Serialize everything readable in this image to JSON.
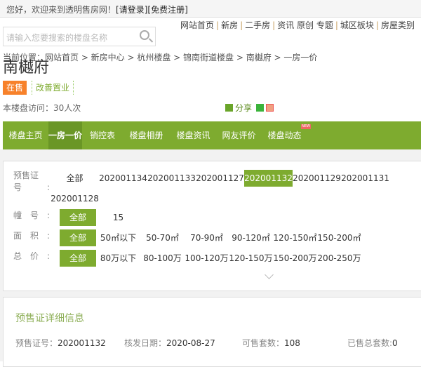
{
  "topbar": {
    "greeting": "您好，欢迎来到透明售房网！",
    "login": "[请登录]",
    "register": "[免费注册]"
  },
  "toplinks": [
    "网站首页",
    "新房",
    "二手房",
    "资讯 原创 专题",
    "城区板块",
    "房屋类别"
  ],
  "search": {
    "placeholder": "请输入您要搜索的楼盘名称",
    "icon": "search-icon"
  },
  "breadcrumb": "当前位置：网站首页 > 新房中心 > 杭州楼盘 > 锦南街道楼盘 > 南樾府 > 一房一价",
  "title": "南樾府",
  "tags": {
    "status": "在售",
    "type": "改善置业"
  },
  "visits": "本楼盘访问：30人次",
  "share": "分享",
  "nav": {
    "items": [
      "楼盘主页",
      "一房一价",
      "销控表",
      "楼盘相册",
      "楼盘资讯",
      "网友评价",
      "楼盘动态"
    ],
    "active": "一房一价",
    "new_badge": "NEW"
  },
  "filters": {
    "cert": {
      "label": "预售证号:",
      "options": [
        "全部",
        "202001134",
        "202001133",
        "202001127",
        "202001132",
        "202001129",
        "202001131",
        "202001128"
      ],
      "selected": "202001132"
    },
    "building": {
      "label": "幢号:",
      "options": [
        "全部",
        "15"
      ],
      "selected": "全部"
    },
    "area": {
      "label": "面积:",
      "options": [
        "全部",
        "50㎡以下",
        "50-70㎡",
        "70-90㎡",
        "90-120㎡",
        "120-150㎡",
        "150-200㎡"
      ],
      "selected": "全部"
    },
    "price": {
      "label": "总价:",
      "options": [
        "全部",
        "80万以下",
        "80-100万",
        "100-120万",
        "120-150万",
        "150-200万",
        "200-250万"
      ],
      "selected": "全部"
    }
  },
  "detail": {
    "title": "预售证详细信息",
    "cert_label": "预售证号：",
    "cert": "202001132",
    "date_label": "核发日期：",
    "date": "2020-08-27",
    "avail_label": "可售套数：",
    "avail": "108",
    "sold_label": "已售总套数:",
    "sold": "0"
  },
  "colors": {
    "green": "#7eab2f",
    "orange": "#f7812a"
  }
}
